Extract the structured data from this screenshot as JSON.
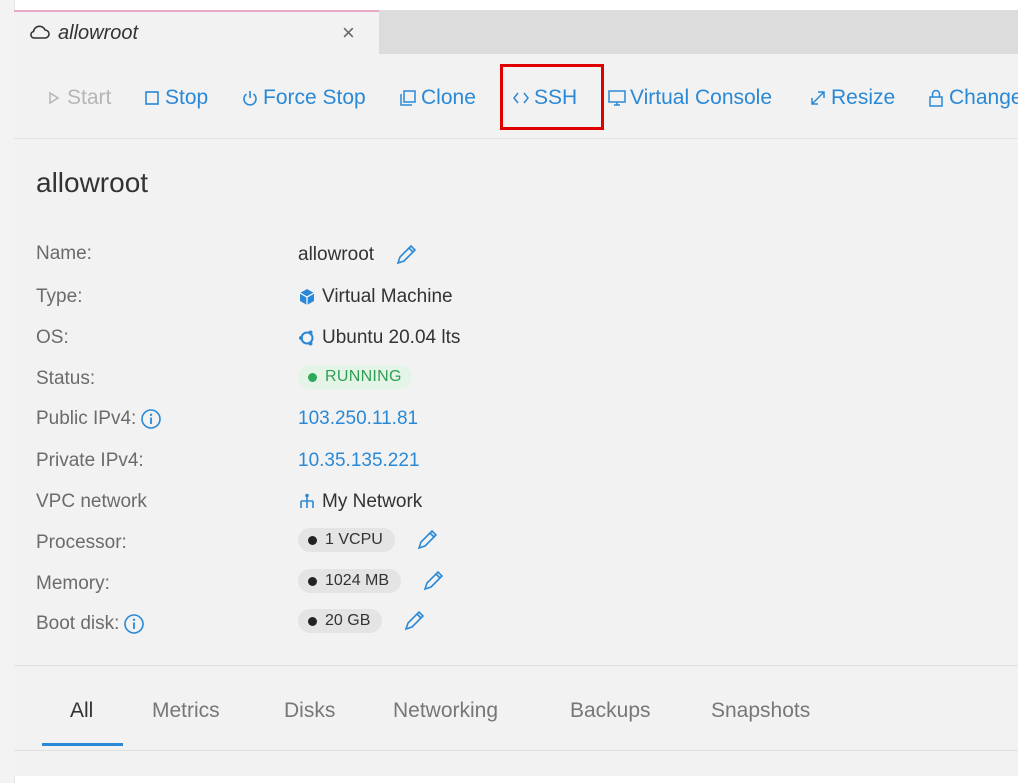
{
  "tab": {
    "title": "allowroot",
    "close": "×"
  },
  "toolbar": {
    "start": "Start",
    "stop": "Stop",
    "force_stop": "Force Stop",
    "clone": "Clone",
    "ssh": "SSH",
    "virtual_console": "Virtual Console",
    "resize": "Resize",
    "change": "Change"
  },
  "details": {
    "title": "allowroot",
    "rows": {
      "name": {
        "label": "Name:",
        "value": "allowroot"
      },
      "type": {
        "label": "Type:",
        "value": "Virtual Machine"
      },
      "os": {
        "label": "OS:",
        "value": "Ubuntu 20.04 lts"
      },
      "status": {
        "label": "Status:",
        "value": "RUNNING"
      },
      "public_ipv4": {
        "label": "Public IPv4:",
        "value": "103.250.11.81"
      },
      "private_ipv4": {
        "label": "Private IPv4:",
        "value": "10.35.135.221"
      },
      "vpc_network": {
        "label": "VPC network",
        "value": "My Network"
      },
      "processor": {
        "label": "Processor:",
        "value": "1 VCPU"
      },
      "memory": {
        "label": "Memory:",
        "value": "1024 MB"
      },
      "boot_disk": {
        "label": "Boot disk:",
        "value": "20 GB"
      }
    }
  },
  "bottom_tabs": [
    "All",
    "Metrics",
    "Disks",
    "Networking",
    "Backups",
    "Snapshots"
  ],
  "colors": {
    "accent": "#2a89d6",
    "highlight": "#e00000",
    "running": "#2fa85a"
  }
}
